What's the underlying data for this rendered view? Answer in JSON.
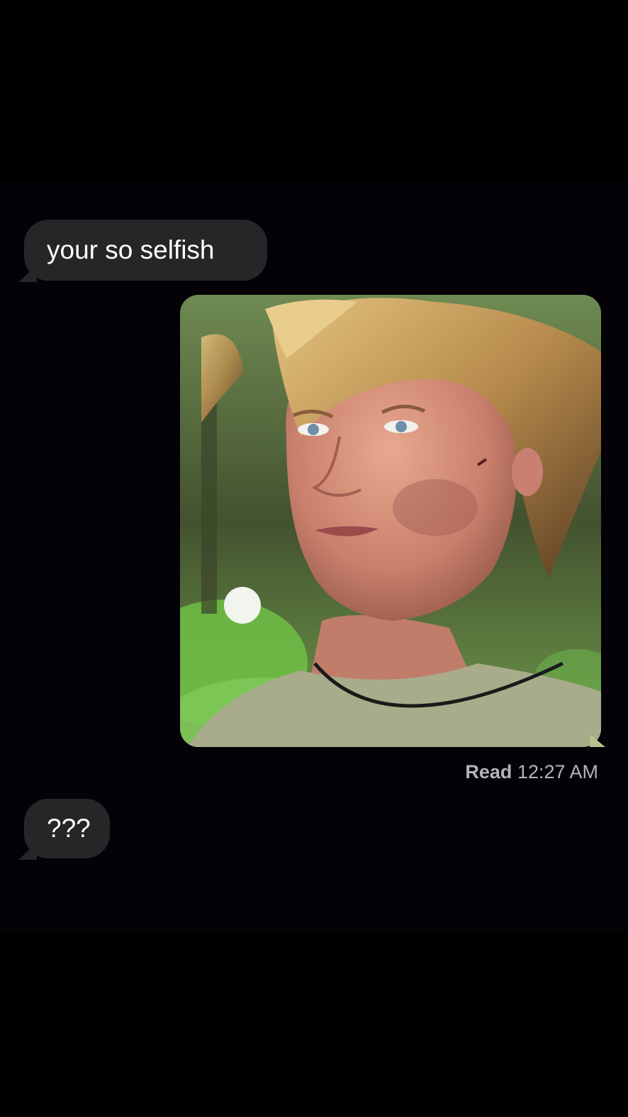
{
  "conversation": {
    "messages": [
      {
        "direction": "incoming",
        "type": "text",
        "text": "your so selfish"
      },
      {
        "direction": "outgoing",
        "type": "image",
        "image_subject": "photo of a blond young man with a dirty, bruised face"
      },
      {
        "direction": "incoming",
        "type": "text",
        "text": "???"
      }
    ],
    "receipt": {
      "status": "Read",
      "time": "12:27 AM"
    }
  },
  "colors": {
    "background": "#000000",
    "incoming_bubble": "#262628",
    "incoming_text": "#ffffff",
    "receipt_text": "#b4b4b8"
  }
}
